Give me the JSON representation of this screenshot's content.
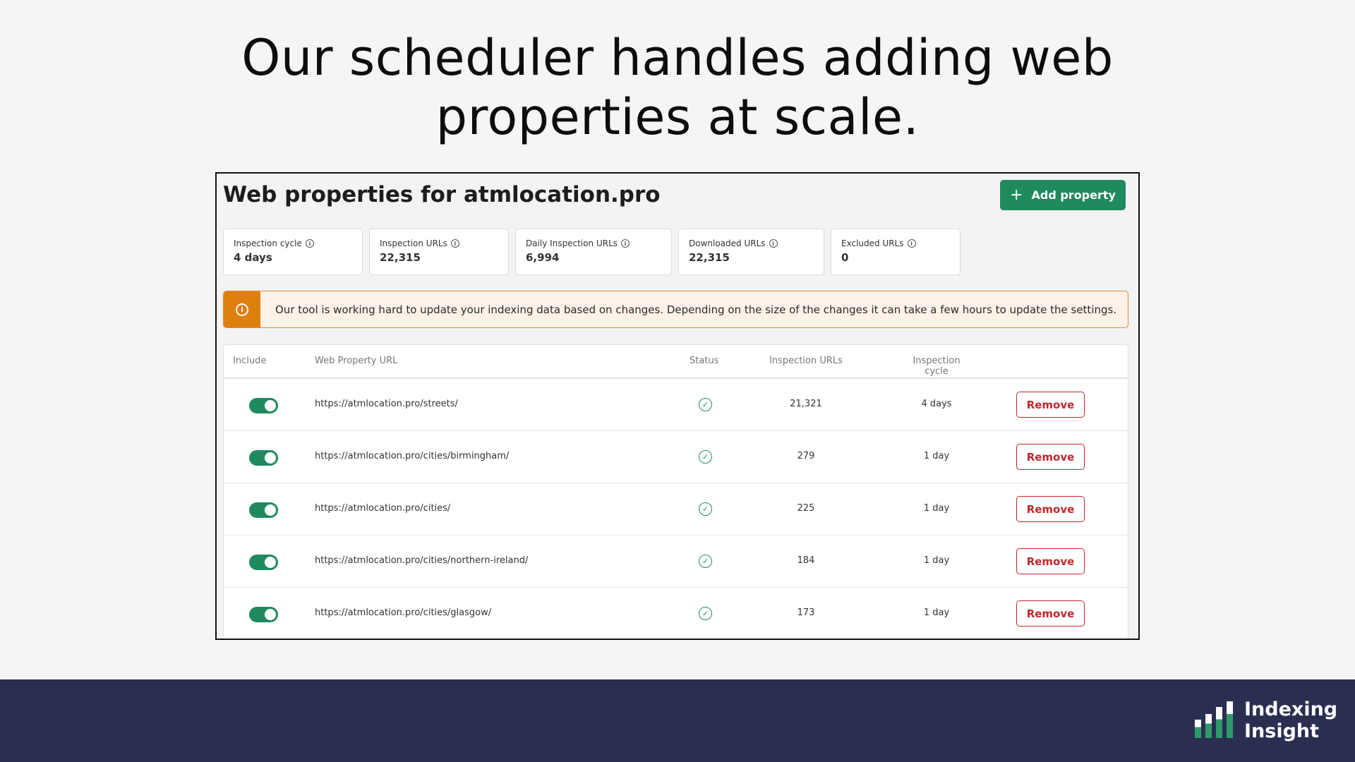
{
  "headline": {
    "line1": "Our scheduler handles adding web",
    "line2": "properties at scale."
  },
  "app": {
    "title": "Web properties for atmlocation.pro",
    "add_button": "Add property"
  },
  "stats": [
    {
      "label": "Inspection cycle",
      "value": "4 days"
    },
    {
      "label": "Inspection URLs",
      "value": "22,315"
    },
    {
      "label": "Daily Inspection URLs",
      "value": "6,994"
    },
    {
      "label": "Downloaded URLs",
      "value": "22,315"
    },
    {
      "label": "Excluded URLs",
      "value": "0"
    }
  ],
  "alert": {
    "text": "Our tool is working hard to update your indexing data based on changes. Depending on the size of the changes it can take a few hours to update the settings."
  },
  "table": {
    "headers": {
      "include": "Include",
      "url": "Web Property URL",
      "status": "Status",
      "inspection_urls": "Inspection URLs",
      "inspection_cycle": "Inspection cycle"
    },
    "rows": [
      {
        "url": "https://atmlocation.pro/streets/",
        "inspection_urls": "21,321",
        "cycle": "4 days",
        "include": true,
        "status": "ok",
        "action": "Remove"
      },
      {
        "url": "https://atmlocation.pro/cities/birmingham/",
        "inspection_urls": "279",
        "cycle": "1 day",
        "include": true,
        "status": "ok",
        "action": "Remove"
      },
      {
        "url": "https://atmlocation.pro/cities/",
        "inspection_urls": "225",
        "cycle": "1 day",
        "include": true,
        "status": "ok",
        "action": "Remove"
      },
      {
        "url": "https://atmlocation.pro/cities/northern-ireland/",
        "inspection_urls": "184",
        "cycle": "1 day",
        "include": true,
        "status": "ok",
        "action": "Remove"
      },
      {
        "url": "https://atmlocation.pro/cities/glasgow/",
        "inspection_urls": "173",
        "cycle": "1 day",
        "include": true,
        "status": "ok",
        "action": "Remove"
      }
    ]
  },
  "brand": {
    "line1": "Indexing",
    "line2": "Insight"
  },
  "colors": {
    "primary_green": "#1f8a5e",
    "warning_orange": "#df7f0e",
    "danger_red": "#c0272d",
    "footer_navy": "#2a2e50"
  },
  "icons": {
    "add": "plus-icon",
    "info": "info-icon",
    "alert": "info-circle-icon",
    "status": "check-circle-icon"
  }
}
